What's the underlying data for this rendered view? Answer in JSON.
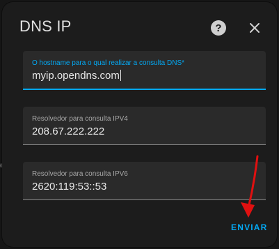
{
  "dialog": {
    "title": "DNS IP",
    "help_icon": "help-circle-icon",
    "close_icon": "close-icon"
  },
  "fields": {
    "hostname": {
      "label": "O hostname para o qual realizar a consulta DNS*",
      "value": "myip.opendns.com"
    },
    "ipv4": {
      "label": "Resolvedor para consulta IPV4",
      "value": "208.67.222.222"
    },
    "ipv6": {
      "label": "Resolvedor para consulta IPV6",
      "value": "2620:119:53::53"
    }
  },
  "actions": {
    "submit_label": "ENVIAR"
  },
  "annotation": {
    "arrow_icon": "red-arrow-icon"
  },
  "background": {
    "partial_glyph": "c"
  },
  "colors": {
    "accent": "#03a9f4",
    "dialog_bg": "#1c1c1c",
    "field_bg": "#2a2a2a",
    "annotation_red": "#e01010"
  }
}
